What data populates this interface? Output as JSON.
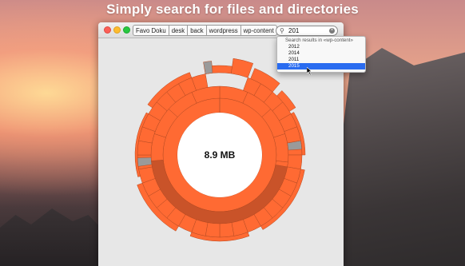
{
  "tagline": "Simply search for files and directories",
  "window": {
    "breadcrumbs": [
      "Favo Doku",
      "desk",
      "back",
      "wordpress",
      "wp-content"
    ],
    "search": {
      "value": "201"
    }
  },
  "chart": {
    "center_label": "8.9 MB",
    "color": "#ff6a33",
    "color_dark": "#c95329"
  },
  "dropdown": {
    "header": "Search results in «wp-content»",
    "items": [
      "2012",
      "2014",
      "2011",
      "2015"
    ],
    "selected_index": 3
  },
  "colors": {
    "accent": "#2a6cf0",
    "sunburst": "#ff6a33"
  }
}
